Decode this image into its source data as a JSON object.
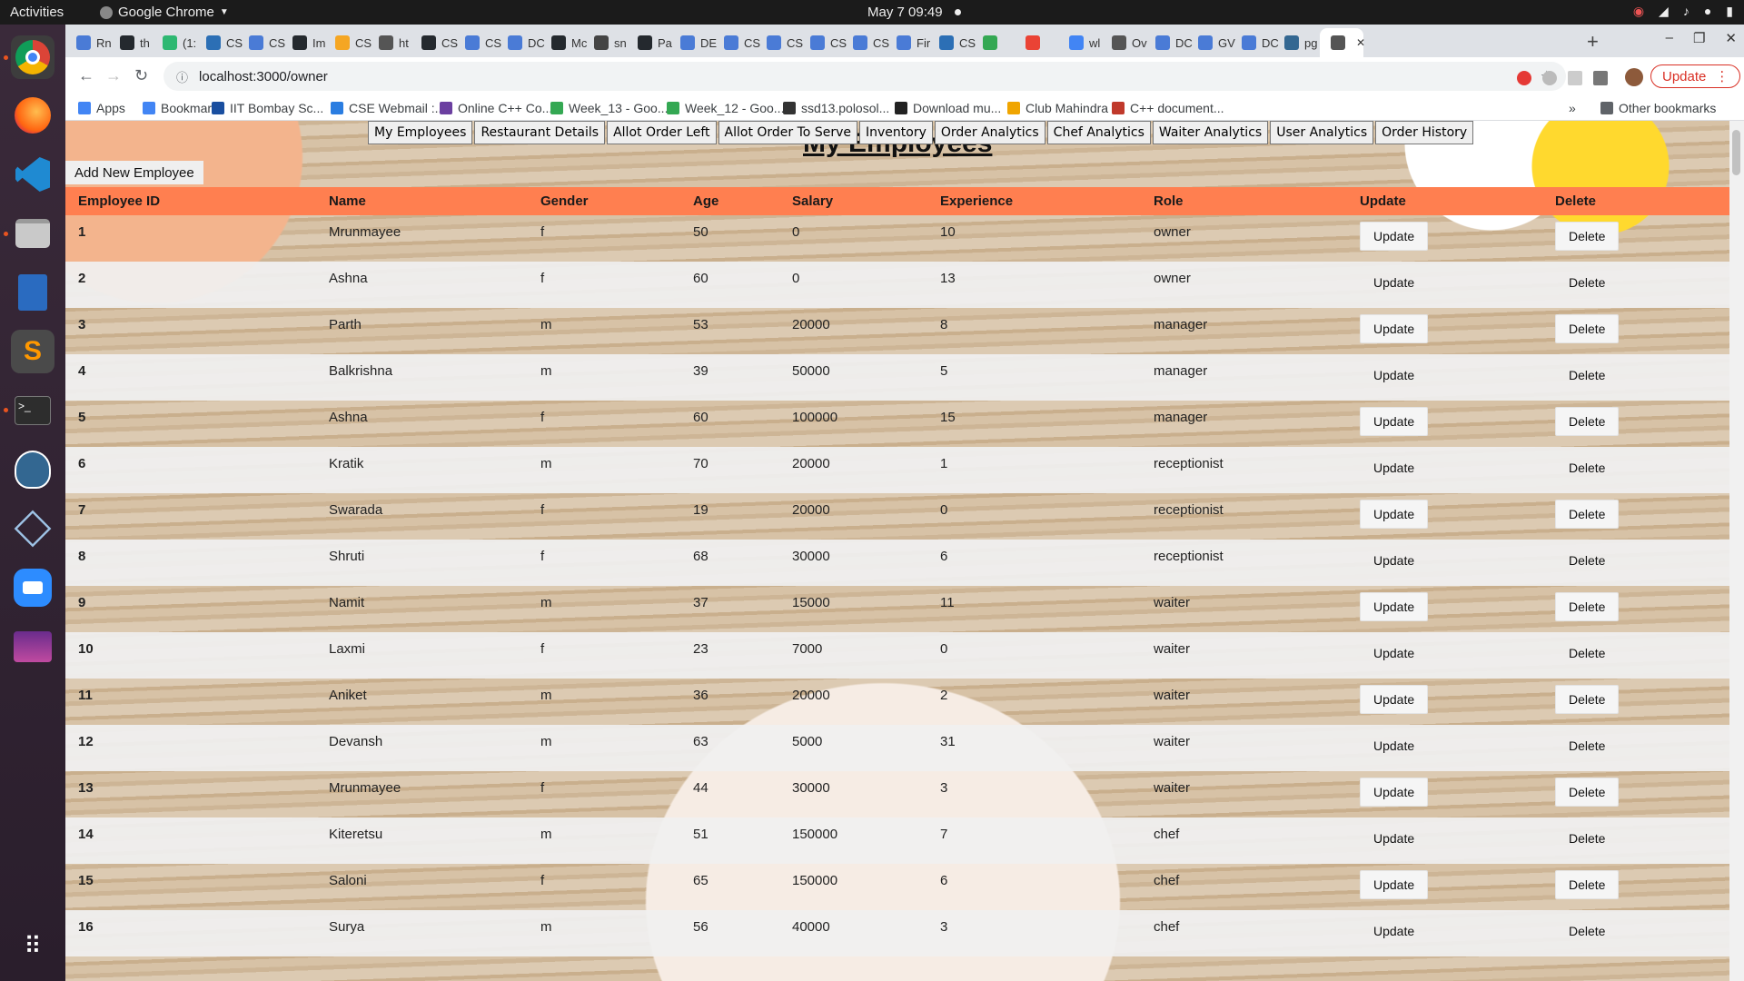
{
  "topbar": {
    "activities": "Activities",
    "app": "Google Chrome",
    "clock": "May 7  09:49"
  },
  "tabs": [
    {
      "label": "Rn",
      "color": "#4a7bd6"
    },
    {
      "label": "th",
      "color": "#24292e"
    },
    {
      "label": "(1:",
      "color": "#2eb872"
    },
    {
      "label": "CS",
      "color": "#2c6fb5"
    },
    {
      "label": "CS",
      "color": "#4a7bd6"
    },
    {
      "label": "Im",
      "color": "#24292e"
    },
    {
      "label": "CS",
      "color": "#f5a623"
    },
    {
      "label": "ht",
      "color": "#555"
    },
    {
      "label": "CS",
      "color": "#24292e"
    },
    {
      "label": "CS",
      "color": "#4a7bd6"
    },
    {
      "label": "DC",
      "color": "#4a7bd6"
    },
    {
      "label": "Mc",
      "color": "#24292e"
    },
    {
      "label": "sn",
      "color": "#444"
    },
    {
      "label": "Pa",
      "color": "#24292e"
    },
    {
      "label": "DE",
      "color": "#4a7bd6"
    },
    {
      "label": "CS",
      "color": "#4a7bd6"
    },
    {
      "label": "CS",
      "color": "#4a7bd6"
    },
    {
      "label": "CS",
      "color": "#4a7bd6"
    },
    {
      "label": "CS",
      "color": "#4a7bd6"
    },
    {
      "label": "Fir",
      "color": "#4a7bd6"
    },
    {
      "label": "CS",
      "color": "#2c6fb5"
    },
    {
      "label": "",
      "color": "#34a853"
    },
    {
      "label": "",
      "color": "#ea4335"
    },
    {
      "label": "wl",
      "color": "#4285f4"
    },
    {
      "label": "Ov",
      "color": "#555"
    },
    {
      "label": "DC",
      "color": "#4a7bd6"
    },
    {
      "label": "GV",
      "color": "#4a7bd6"
    },
    {
      "label": "DC",
      "color": "#4a7bd6"
    },
    {
      "label": "pg",
      "color": "#336791"
    },
    {
      "label": "",
      "color": "#555"
    }
  ],
  "toolbar": {
    "url": "localhost:3000/owner",
    "update_label": "Update"
  },
  "bookmarks": [
    {
      "label": "Apps",
      "color": "#4285f4"
    },
    {
      "label": "Bookmarks",
      "color": "#4285f4"
    },
    {
      "label": "IIT Bombay Sc...",
      "color": "#1a4fa0"
    },
    {
      "label": "CSE Webmail :...",
      "color": "#2a7de1"
    },
    {
      "label": "Online C++ Co...",
      "color": "#6b3fa0"
    },
    {
      "label": "Week_13 - Goo...",
      "color": "#34a853"
    },
    {
      "label": "Week_12 - Goo...",
      "color": "#34a853"
    },
    {
      "label": "ssd13.polosol...",
      "color": "#333"
    },
    {
      "label": "Download mu...",
      "color": "#222"
    },
    {
      "label": "Club Mahindra",
      "color": "#f0a500"
    },
    {
      "label": "C++ document...",
      "color": "#c0392b"
    }
  ],
  "other_bookmarks": "Other bookmarks",
  "nav": {
    "my_employees": "My Employees",
    "restaurant_details": "Restaurant Details",
    "allot_order_left": "Allot Order Left",
    "allot_order_to_serve": "Allot Order To Serve",
    "inventory": "Inventory",
    "order_analytics": "Order Analytics",
    "chef_analytics": "Chef Analytics",
    "waiter_analytics": "Waiter Analytics",
    "user_analytics": "User Analytics",
    "order_history": "Order History"
  },
  "page": {
    "title": "My Employees",
    "add_button": "Add New Employee"
  },
  "table": {
    "headers": [
      "Employee ID",
      "Name",
      "Gender",
      "Age",
      "Salary",
      "Experience",
      "Role",
      "Update",
      "Delete"
    ],
    "update_label": "Update",
    "delete_label": "Delete",
    "rows": [
      {
        "id": "1",
        "name": "Mrunmayee",
        "gender": "f",
        "age": "50",
        "salary": "0",
        "experience": "10",
        "role": "owner"
      },
      {
        "id": "2",
        "name": "Ashna",
        "gender": "f",
        "age": "60",
        "salary": "0",
        "experience": "13",
        "role": "owner"
      },
      {
        "id": "3",
        "name": "Parth",
        "gender": "m",
        "age": "53",
        "salary": "20000",
        "experience": "8",
        "role": "manager"
      },
      {
        "id": "4",
        "name": "Balkrishna",
        "gender": "m",
        "age": "39",
        "salary": "50000",
        "experience": "5",
        "role": "manager"
      },
      {
        "id": "5",
        "name": "Ashna",
        "gender": "f",
        "age": "60",
        "salary": "100000",
        "experience": "15",
        "role": "manager"
      },
      {
        "id": "6",
        "name": "Kratik",
        "gender": "m",
        "age": "70",
        "salary": "20000",
        "experience": "1",
        "role": "receptionist"
      },
      {
        "id": "7",
        "name": "Swarada",
        "gender": "f",
        "age": "19",
        "salary": "20000",
        "experience": "0",
        "role": "receptionist"
      },
      {
        "id": "8",
        "name": "Shruti",
        "gender": "f",
        "age": "68",
        "salary": "30000",
        "experience": "6",
        "role": "receptionist"
      },
      {
        "id": "9",
        "name": "Namit",
        "gender": "m",
        "age": "37",
        "salary": "15000",
        "experience": "11",
        "role": "waiter"
      },
      {
        "id": "10",
        "name": "Laxmi",
        "gender": "f",
        "age": "23",
        "salary": "7000",
        "experience": "0",
        "role": "waiter"
      },
      {
        "id": "11",
        "name": "Aniket",
        "gender": "m",
        "age": "36",
        "salary": "20000",
        "experience": "2",
        "role": "waiter"
      },
      {
        "id": "12",
        "name": "Devansh",
        "gender": "m",
        "age": "63",
        "salary": "5000",
        "experience": "31",
        "role": "waiter"
      },
      {
        "id": "13",
        "name": "Mrunmayee",
        "gender": "f",
        "age": "44",
        "salary": "30000",
        "experience": "3",
        "role": "waiter"
      },
      {
        "id": "14",
        "name": "Kiteretsu",
        "gender": "m",
        "age": "51",
        "salary": "150000",
        "experience": "7",
        "role": "chef"
      },
      {
        "id": "15",
        "name": "Saloni",
        "gender": "f",
        "age": "65",
        "salary": "150000",
        "experience": "6",
        "role": "chef"
      },
      {
        "id": "16",
        "name": "Surya",
        "gender": "m",
        "age": "56",
        "salary": "40000",
        "experience": "3",
        "role": "chef"
      }
    ]
  },
  "colors": {
    "table_header": "#ff7f50",
    "chrome_update": "#d93025"
  }
}
